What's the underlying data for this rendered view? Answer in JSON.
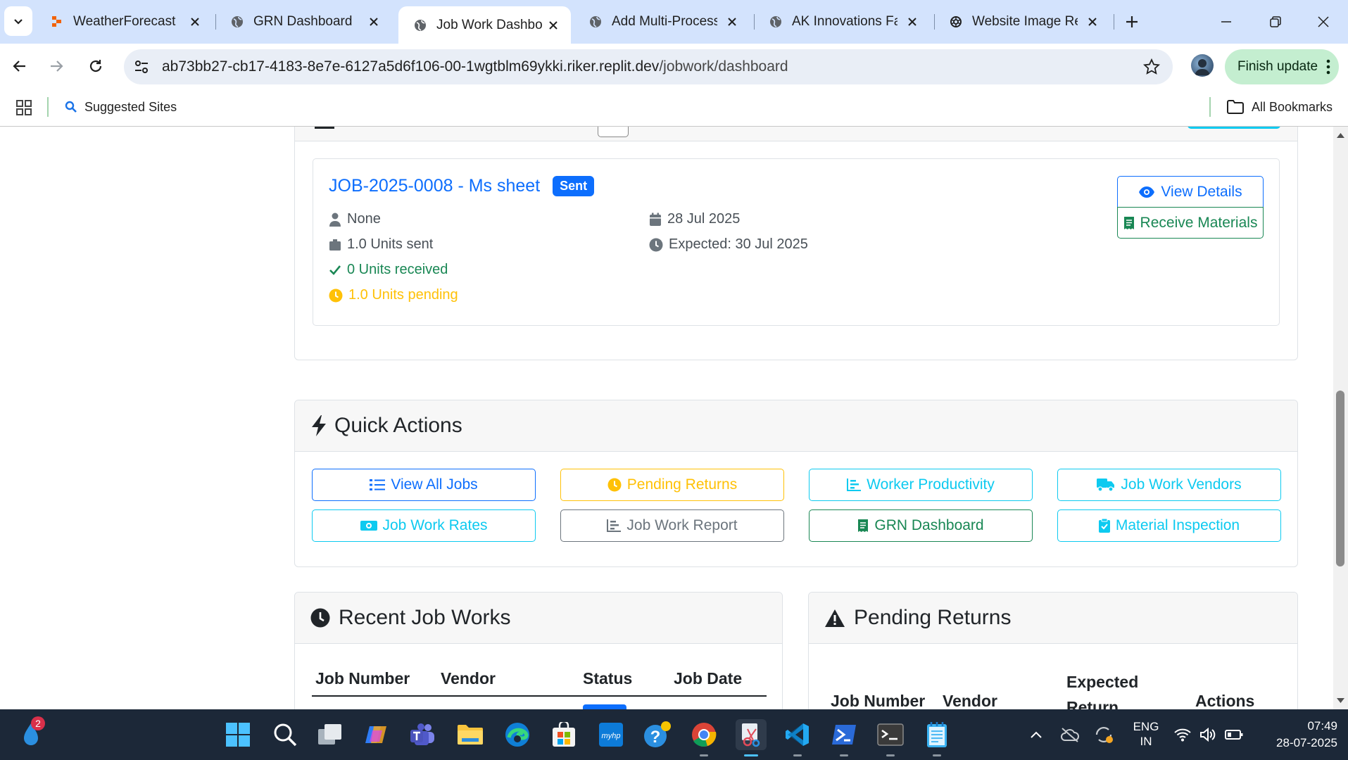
{
  "browser": {
    "tabs": [
      {
        "title": "WeatherForecast -",
        "icon": "replit-icon"
      },
      {
        "title": "GRN Dashboard",
        "icon": "globe-icon"
      },
      {
        "title": "Job Work Dashboard",
        "icon": "globe-icon",
        "active": true
      },
      {
        "title": "Add Multi-Process",
        "icon": "globe-icon"
      },
      {
        "title": "AK Innovations Factory",
        "icon": "globe-icon"
      },
      {
        "title": "Website Image Recreation",
        "icon": "openai-icon"
      }
    ],
    "url_host": "ab73bb27-cb17-4183-8e7e-6127a5d6f106-00-1wgtblm69ykki.riker.replit.dev",
    "url_path": "/jobwork/dashboard",
    "finish_update": "Finish update",
    "suggested_sites": "Suggested Sites",
    "all_bookmarks": "All Bookmarks"
  },
  "active_jobs": {
    "job_title": "JOB-2025-0008 - Ms sheet",
    "status": "Sent",
    "worker": "None",
    "units_sent": "1.0 Units sent",
    "units_received": "0 Units received",
    "units_pending": "1.0 Units pending",
    "date": "28 Jul 2025",
    "expected": "Expected: 30 Jul 2025",
    "view_details": "View Details",
    "receive_materials": "Receive Materials"
  },
  "quick_actions": {
    "title": "Quick Actions",
    "buttons": [
      {
        "label": "View All Jobs",
        "color": "#0d6efd"
      },
      {
        "label": "Pending Returns",
        "color": "#ffc107"
      },
      {
        "label": "Worker Productivity",
        "color": "#0dcaf0"
      },
      {
        "label": "Job Work Vendors",
        "color": "#0dcaf0"
      },
      {
        "label": "Job Work Rates",
        "color": "#0dcaf0"
      },
      {
        "label": "Job Work Report",
        "color": "#6c757d"
      },
      {
        "label": "GRN Dashboard",
        "color": "#198754"
      },
      {
        "label": "Material Inspection",
        "color": "#0dcaf0"
      }
    ]
  },
  "recent": {
    "title": "Recent Job Works",
    "columns": [
      "Job Number",
      "Vendor",
      "Status",
      "Job Date"
    ]
  },
  "pending_returns": {
    "title": "Pending Returns",
    "columns": [
      "Job Number",
      "Vendor",
      "Expected Return",
      "Actions"
    ]
  },
  "taskbar": {
    "badge_count": "2",
    "lang_line1": "ENG",
    "lang_line2": "IN",
    "time": "07:49",
    "date": "28-07-2025"
  },
  "colors": {
    "primary": "#0d6efd",
    "success": "#198754",
    "warning": "#ffc107",
    "info": "#0dcaf0",
    "secondary": "#6c757d",
    "tab_strip": "#d3e3fd"
  }
}
